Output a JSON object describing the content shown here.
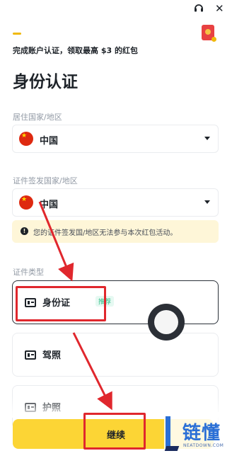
{
  "header": {
    "support_icon": "headset-icon",
    "close_icon": "close-icon",
    "reward_icon": "red-envelope-icon"
  },
  "promo": {
    "text": "完成账户认证，领取最高 $3 的红包"
  },
  "page": {
    "title": "身份认证"
  },
  "residence": {
    "label": "居住国家/地区",
    "value": "中国"
  },
  "issuing": {
    "label": "证件签发国家/地区",
    "value": "中国"
  },
  "warning": {
    "text": "您的证件签发国/地区无法参与本次红包活动。"
  },
  "doc_type": {
    "label": "证件类型",
    "options": [
      {
        "label": "身份证",
        "badge": "推荐"
      },
      {
        "label": "驾照"
      },
      {
        "label": "护照"
      }
    ]
  },
  "actions": {
    "continue": "继续"
  },
  "watermark": {
    "name": "链懂",
    "domain": "NEATDOWN.COM"
  },
  "colors": {
    "accent": "#fcd535",
    "highlight": "#e0272d",
    "recommend": "#2ebd85",
    "warning_bg": "#fef6d8"
  }
}
